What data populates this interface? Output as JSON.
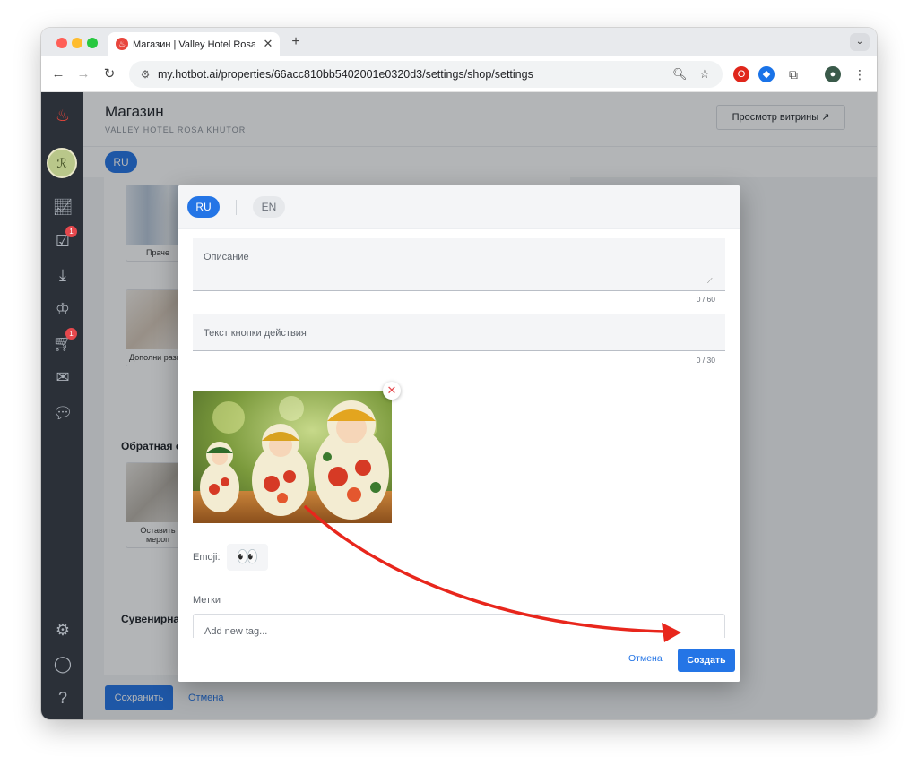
{
  "browser": {
    "tab_title": "Магазин | Valley Hotel Rosa Khutor",
    "tab_close": "✕",
    "new_tab": "+",
    "url": "my.hotbot.ai/properties/66acc810bb5402001e0320d3/settings/shop/settings"
  },
  "app": {
    "page_title": "Магазин",
    "page_subtitle": "VALLEY HOTEL ROSA KHUTOR",
    "storefront_button": "Просмотр витрины ↗",
    "lang_active": "RU",
    "sidebar_badges": {
      "tasks": "1",
      "cart": "1"
    },
    "background_cards": [
      {
        "label": "Праче"
      },
      {
        "label": "Дополни разме"
      },
      {
        "label": "Оставить мероп"
      }
    ],
    "background_sections": [
      "Обратная с",
      "Сувенирна"
    ],
    "save_button": "Сохранить",
    "cancel_link": "Отмена"
  },
  "modal": {
    "lang_tabs": [
      {
        "label": "RU",
        "active": true
      },
      {
        "label": "EN",
        "active": false
      }
    ],
    "description": {
      "placeholder": "Описание",
      "counter": "0 / 60"
    },
    "action_text": {
      "placeholder": "Текст кнопки действия",
      "counter": "0 / 30"
    },
    "image_remove": "✕",
    "emoji_label": "Emoji:",
    "emoji_value": "👀",
    "tags_label": "Метки",
    "tags_placeholder": "Add new tag...",
    "footer_cancel": "Отмена",
    "create_button": "Создать"
  },
  "colors": {
    "accent": "#2475e6",
    "sidebar": "#2b3038",
    "badge": "#e5484d",
    "annotation_arrow": "#e8261c"
  }
}
